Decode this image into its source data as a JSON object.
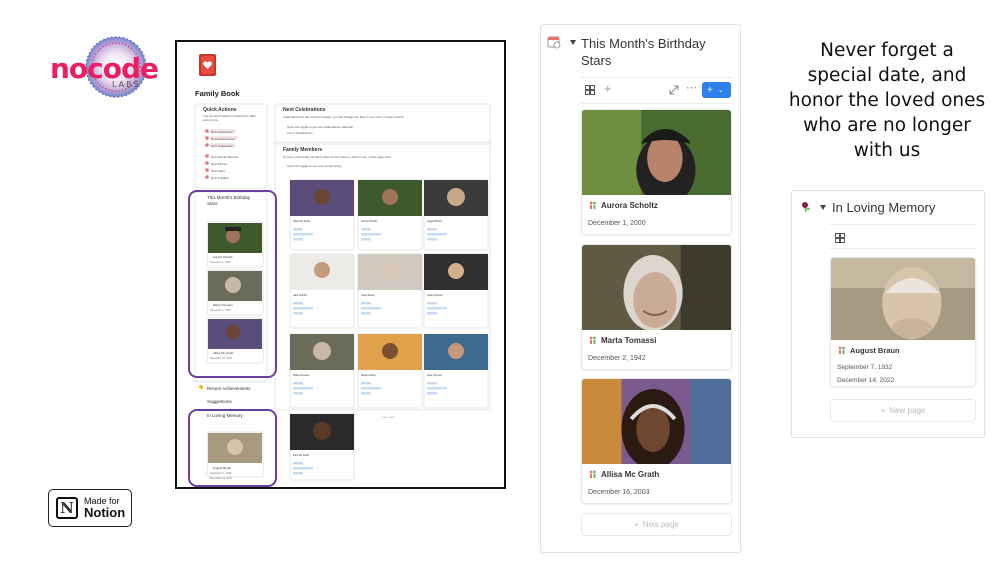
{
  "brand": {
    "logo_main": "nocode",
    "logo_sub": "LABS"
  },
  "badge": {
    "line1": "Made for",
    "line2": "Notion"
  },
  "tagline": "Never forget a special date, and honor the loved ones who are no longer with us",
  "birthday_panel": {
    "title": "This Month's Birthday Stars",
    "icon": "calendar-icon",
    "new_page": "New page",
    "cards": [
      {
        "name": "Aurora Scholtz",
        "date": "December 1, 2000",
        "photo": "young-woman-cap"
      },
      {
        "name": "Marta Tomassi",
        "date": "December 2, 1942",
        "photo": "elderly-woman"
      },
      {
        "name": "Allisa Mc Grath",
        "date": "December 16, 2003",
        "photo": "teen-headphones"
      }
    ]
  },
  "memory_panel": {
    "title": "In Loving Memory",
    "new_page": "New page",
    "card": {
      "name": "August Braun",
      "date1": "September 7, 1932",
      "date2": "December 14, 2022",
      "photo": "elderly-man"
    }
  },
  "screenshot": {
    "page_title": "Family Book",
    "quick_actions": "Quick Actions",
    "quick_actions_desc": "The shortcuts below correspond to data entry forms",
    "qa_items": [
      "New Celebration",
      "New Achievement",
      "New Suggestion",
      "New Family Member",
      "New Picture",
      "New Place",
      "New Tradition"
    ],
    "birthday_title": "This Month's Birthday Stars",
    "birthday_names": [
      "Aurora Scholtz",
      "Marta Tomassi",
      "Allisa Mc Grath"
    ],
    "birthday_dates": [
      "December 1, 2000",
      "December 2, 1942",
      "December 16, 2003"
    ],
    "recent_achievements": "Recent Achievements",
    "suggestions": "Suggestions",
    "in_loving_memory": "In Loving Memory",
    "memory_name": "August Braun",
    "memory_dates": [
      "September 7, 1932",
      "December 14, 2022"
    ],
    "next_celebrations": "Next Celebrations",
    "next_celebrations_desc": "Celebrations for the next four weeks; you can change the filter to see more or fewer events",
    "nc_toggle": "Open the toggle to see the Celebrations Calendar",
    "nc_list": "List of Celebrations",
    "family_members": "Family Members",
    "family_members_desc": "To enter your family members click on the button or click on the + New page card",
    "fm_toggle": "Open the toggle to see your lovely family",
    "members": [
      "Allisa Mc Grath",
      "Aurora Scholtz",
      "August Braun",
      "Jake Scholtz",
      "Laura Braun",
      "Jason Scholtz",
      "Marta Tomassi",
      "Mason Braun",
      "Peter Scholtz",
      "Paul Mc Grath"
    ],
    "member_rows": [
      "Parents",
      "Daughters & Sons",
      "Siblings"
    ],
    "new_page": "New page"
  }
}
